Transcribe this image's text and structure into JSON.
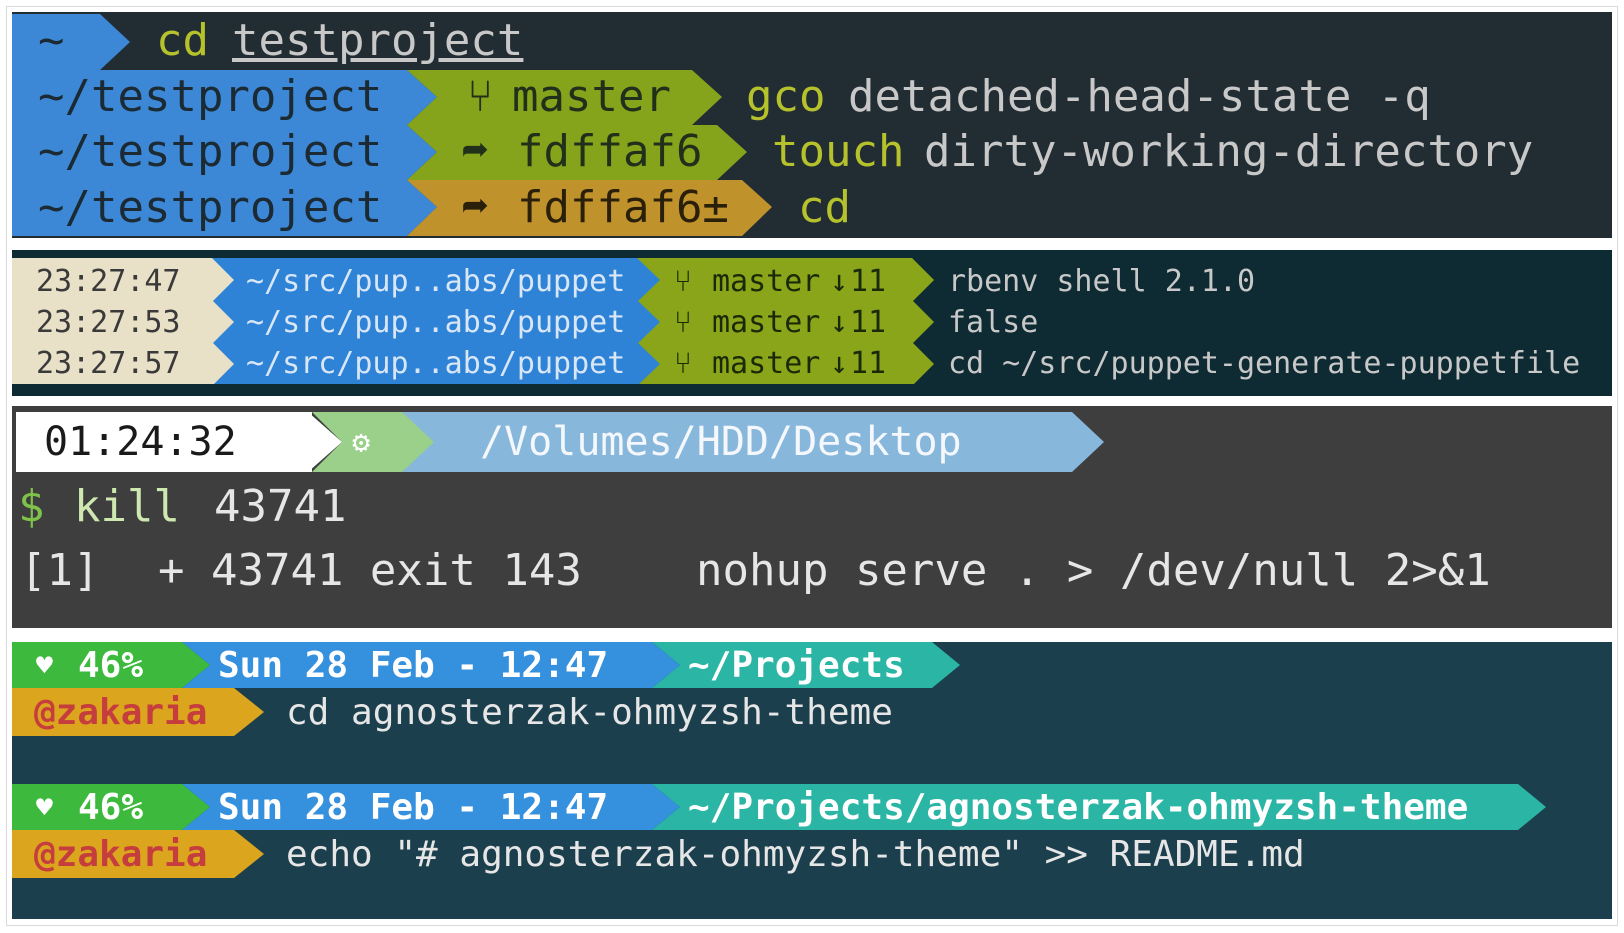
{
  "colors": {
    "p1_bg": "#222d33",
    "blue": "#3d88d6",
    "green": "#86a31c",
    "orange": "#c0922c",
    "p2_bg": "#0e2a33",
    "cream": "#e9e0c8",
    "p2_blue": "#2e83d6",
    "p2_green": "#8aa51a",
    "p3_bg": "#3e3e3e",
    "p4_bg": "#1c3f4e",
    "p4_green": "#3dba3d",
    "p4_blue": "#3590dd",
    "p4_teal": "#2ab5a5",
    "p4_yellow": "#dba51e",
    "user_red": "#c63d3d"
  },
  "icons": {
    "branch": "git-branch-icon",
    "detached": "detached-head-icon",
    "gear": "gear-icon",
    "heart": "heart-icon",
    "behind": "arrow-down-icon"
  },
  "panel1": {
    "home": "~",
    "rows": [
      {
        "cmd_name": "cd",
        "cmd_arg": "testproject"
      },
      {
        "dir": "~/testproject",
        "git": "master",
        "cmd_name": "gco",
        "cmd_arg": "detached-head-state -q"
      },
      {
        "dir": "~/testproject",
        "git": "fdffaf6",
        "cmd_name": "touch",
        "cmd_arg": "dirty-working-directory"
      },
      {
        "dir": "~/testproject",
        "git": "fdffaf6±",
        "cmd_name": "cd",
        "cmd_arg": ""
      }
    ]
  },
  "panel2": {
    "rows": [
      {
        "time": "23:27:47",
        "dir": "~/src/pup..abs/puppet",
        "branch": "master",
        "behind": "11",
        "cmd": "rbenv shell 2.1.0"
      },
      {
        "time": "23:27:53",
        "dir": "~/src/pup..abs/puppet",
        "branch": "master",
        "behind": "11",
        "cmd": "false"
      },
      {
        "time": "23:27:57",
        "dir": "~/src/pup..abs/puppet",
        "branch": "master",
        "behind": "11",
        "cmd": "cd ~/src/puppet-generate-puppetfile"
      }
    ]
  },
  "panel3": {
    "time": "01:24:32",
    "path": "/Volumes/HDD/Desktop",
    "prompt_symbol": "$",
    "cmd_name": "kill",
    "cmd_arg": "43741",
    "output_job": "[1]",
    "output_status": "+ 43741 exit 143",
    "output_cmd": "nohup serve . > /dev/null 2>&1"
  },
  "panel4": {
    "blocks": [
      {
        "battery": "46%",
        "date": "Sun 28 Feb - 12:47",
        "dir": "~/Projects",
        "user": "@zakaria",
        "cmd": "cd agnosterzak-ohmyzsh-theme"
      },
      {
        "battery": "46%",
        "date": "Sun 28 Feb - 12:47",
        "dir": "~/Projects/agnosterzak-ohmyzsh-theme",
        "user": "@zakaria",
        "cmd": "echo \"# agnosterzak-ohmyzsh-theme\" >> README.md"
      }
    ]
  }
}
